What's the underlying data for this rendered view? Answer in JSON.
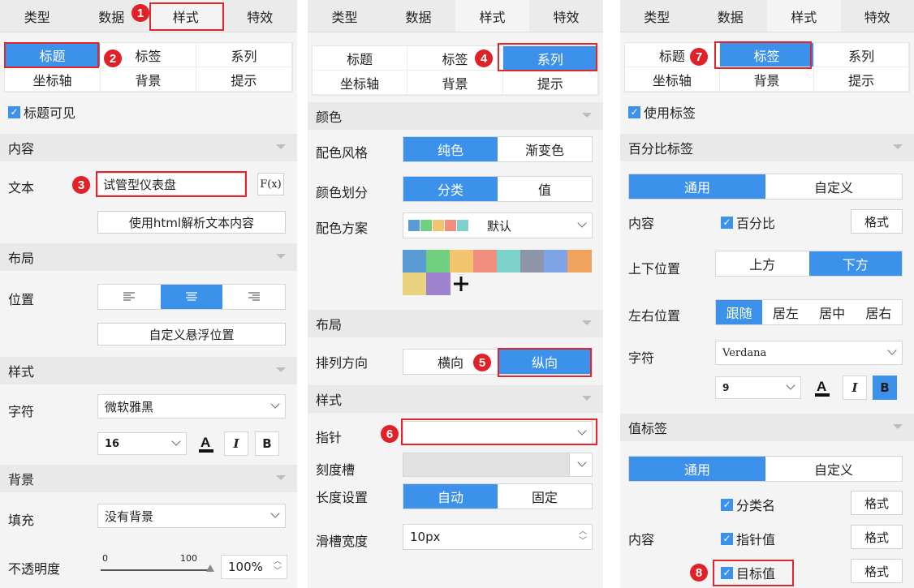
{
  "tabs": [
    "类型",
    "数据",
    "样式",
    "特效"
  ],
  "badges": [
    "1",
    "2",
    "3",
    "4",
    "5",
    "6",
    "7",
    "8"
  ],
  "p1": {
    "subtabs": [
      "标题",
      "标签",
      "系列",
      "坐标轴",
      "背景",
      "提示"
    ],
    "title_visible": "标题可见",
    "content_head": "内容",
    "text_label": "文本",
    "text_value": "试管型仪表盘",
    "fx": "F(x)",
    "html_btn": "使用html解析文本内容",
    "layout_head": "布局",
    "position_label": "位置",
    "custom_float_btn": "自定义悬浮位置",
    "style_head": "样式",
    "char_label": "字符",
    "font": "微软雅黑",
    "font_size": "16",
    "italic": "I",
    "bold": "B",
    "bg_head": "背景",
    "fill_label": "填充",
    "fill_value": "没有背景",
    "opacity_label": "不透明度",
    "opacity_min": "0",
    "opacity_max": "100",
    "opacity_value": "100%"
  },
  "p2": {
    "subtabs": [
      "标题",
      "标签",
      "系列",
      "坐标轴",
      "背景",
      "提示"
    ],
    "color_head": "颜色",
    "scheme_style_label": "配色风格",
    "scheme_style": [
      "纯色",
      "渐变色"
    ],
    "color_div_label": "颜色划分",
    "color_div": [
      "分类",
      "值"
    ],
    "scheme_label": "配色方案",
    "scheme_value": "默认",
    "palette": [
      "#5b9bd5",
      "#70d07f",
      "#f2c46e",
      "#f28e7f",
      "#7dd3cc",
      "#8d96a8",
      "#7ea3e6",
      "#f0a35e",
      "#e8d27f",
      "#9e84cf"
    ],
    "layout_head": "布局",
    "dir_label": "排列方向",
    "dir": [
      "横向",
      "纵向"
    ],
    "style_head": "样式",
    "pointer_label": "指针",
    "groove_label": "刻度槽",
    "length_label": "长度设置",
    "length": [
      "自动",
      "固定"
    ],
    "slot_label": "滑槽宽度",
    "slot_value": "10px"
  },
  "p3": {
    "subtabs": [
      "标题",
      "标签",
      "系列",
      "坐标轴",
      "背景",
      "提示"
    ],
    "use_label": "使用标签",
    "pct_head": "百分比标签",
    "pct_seg": [
      "通用",
      "自定义"
    ],
    "content_label": "内容",
    "pct_check": "百分比",
    "format": "格式",
    "vpos_label": "上下位置",
    "vpos": [
      "上方",
      "下方"
    ],
    "hpos_label": "左右位置",
    "hpos": [
      "跟随",
      "居左",
      "居中",
      "居右"
    ],
    "char_label": "字符",
    "font": "Verdana",
    "font_size": "9",
    "italic": "I",
    "bold": "B",
    "value_head": "值标签",
    "value_seg": [
      "通用",
      "自定义"
    ],
    "checks": [
      "分类名",
      "指针值",
      "目标值"
    ]
  },
  "colors": {
    "accent": "#3c92ea",
    "highlight": "#e0262c"
  }
}
